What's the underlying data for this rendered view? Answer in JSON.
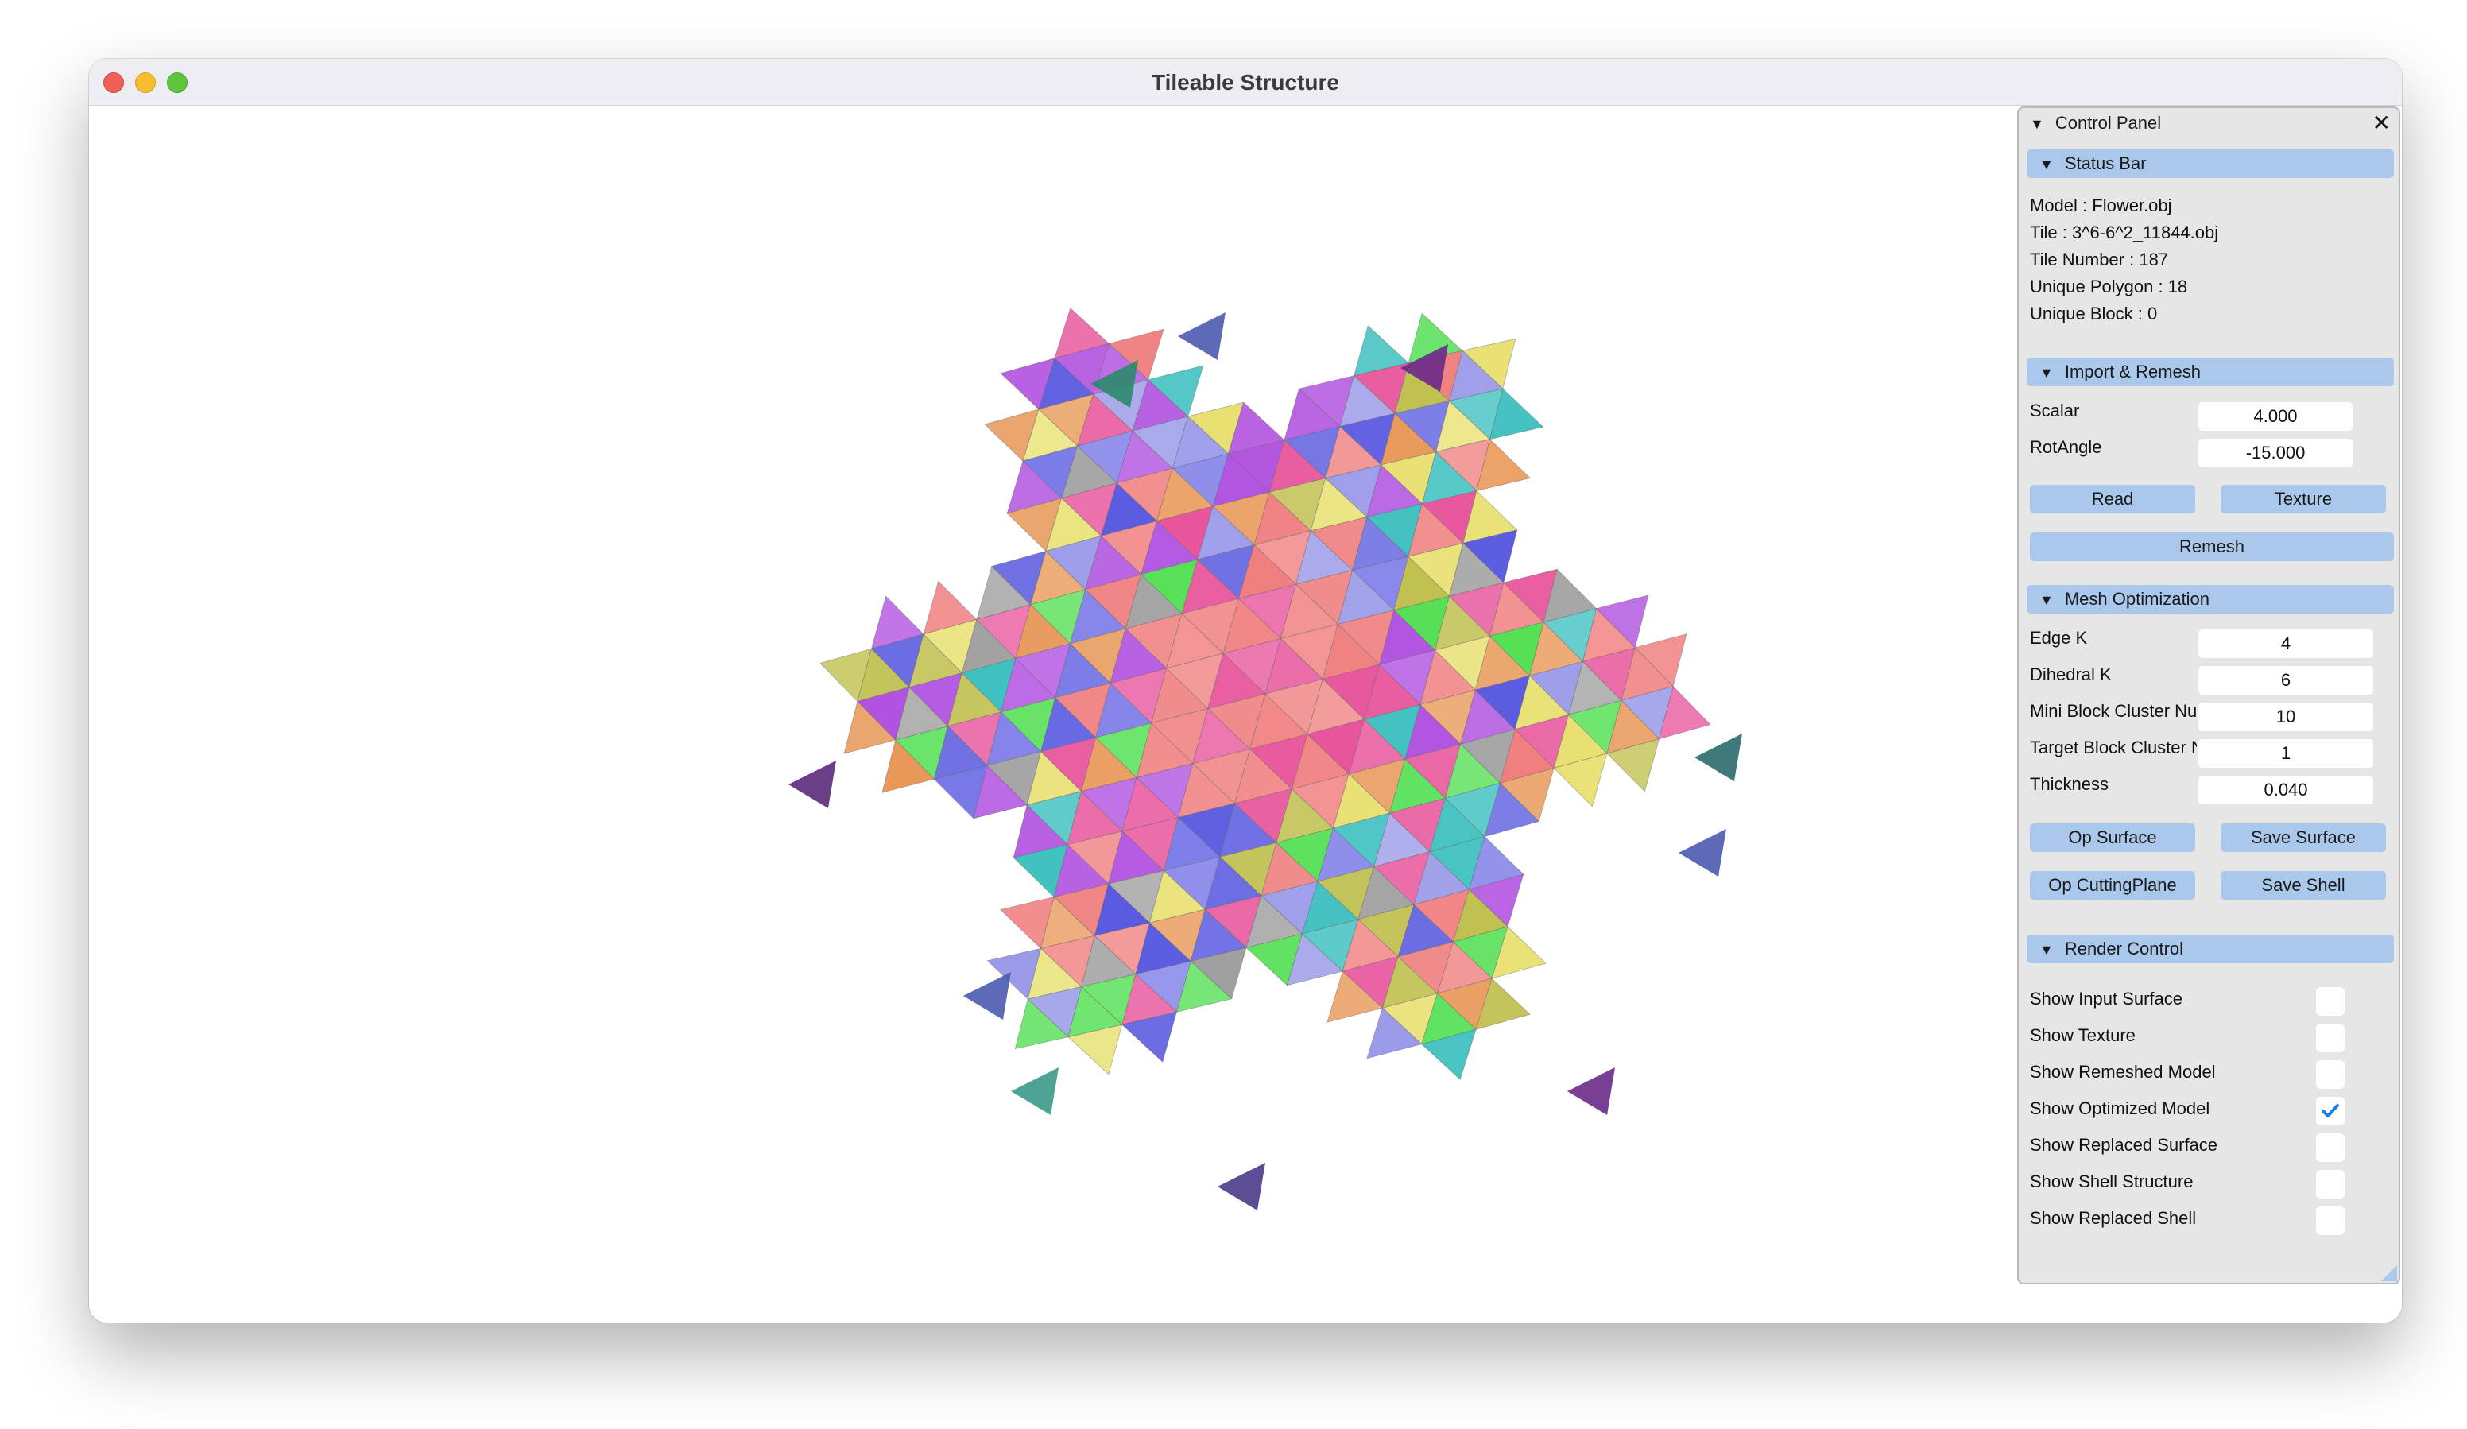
{
  "window": {
    "title": "Tileable Structure"
  },
  "panel": {
    "title": "Control Panel",
    "close_icon": "close-icon",
    "sections": {
      "status": {
        "title": "Status Bar",
        "lines": [
          "Model : Flower.obj",
          "Tile : 3^6-6^2_11844.obj",
          "Tile Number : 187",
          "Unique Polygon : 18",
          "Unique Block : 0"
        ]
      },
      "import": {
        "title": "Import & Remesh",
        "scalar_label": "Scalar",
        "scalar_value": "4.000",
        "rot_label": "RotAngle",
        "rot_value": "-15.000",
        "read_label": "Read",
        "texture_label": "Texture",
        "remesh_label": "Remesh"
      },
      "mesh": {
        "title": "Mesh Optimization",
        "edge_label": "Edge K",
        "edge_value": "4",
        "dihedral_label": "Dihedral K",
        "dihedral_value": "6",
        "mini_label": "Mini Block Cluster Nu",
        "mini_value": "10",
        "target_label": "Target Block Cluster N",
        "target_value": "1",
        "thickness_label": "Thickness",
        "thickness_value": "0.040",
        "op_surface_label": "Op Surface",
        "save_surface_label": "Save Surface",
        "op_cutting_label": "Op CuttingPlane",
        "save_shell_label": "Save Shell"
      },
      "render": {
        "title": "Render Control",
        "options": [
          {
            "label": "Show Input Surface",
            "checked": false
          },
          {
            "label": "Show Texture",
            "checked": false
          },
          {
            "label": "Show Remeshed Model",
            "checked": false
          },
          {
            "label": "Show Optimized Model",
            "checked": true
          },
          {
            "label": "Show Replaced Surface",
            "checked": false
          },
          {
            "label": "Show Shell Structure",
            "checked": false
          },
          {
            "label": "Show Replaced Shell",
            "checked": false
          }
        ]
      }
    }
  },
  "colors": {
    "panel_bg": "#e6e6e6",
    "header_blue": "#aac8eb",
    "check_blue": "#1a7ee8",
    "tile_palette": [
      "#f08080",
      "#e8559c",
      "#e8e070",
      "#5a5ae0",
      "#55e055",
      "#b050e0",
      "#40c0c0",
      "#e89858",
      "#9898e8",
      "#a0a0a0",
      "#c0c050",
      "#7a7ae8"
    ]
  }
}
